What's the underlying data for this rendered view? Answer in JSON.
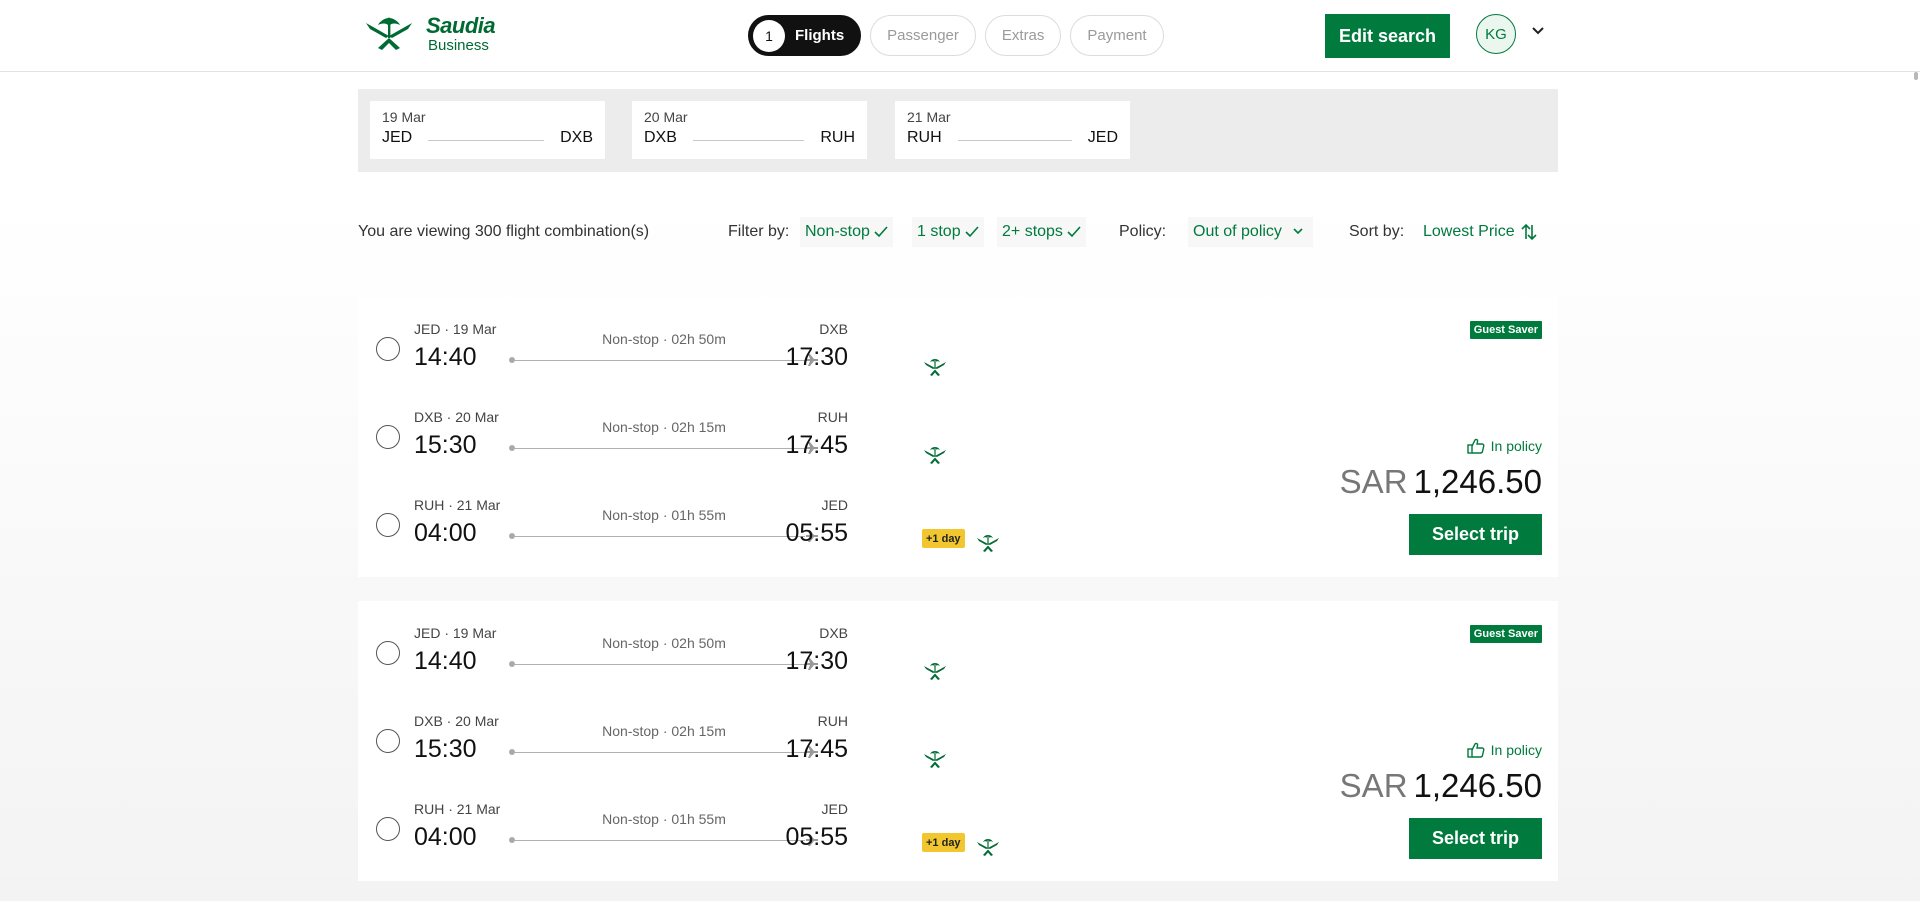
{
  "brand": {
    "name": "Saudia",
    "sub": "Business"
  },
  "steps": [
    {
      "num": "1",
      "label": "Flights",
      "active": true
    },
    {
      "label": "Passenger"
    },
    {
      "label": "Extras"
    },
    {
      "label": "Payment"
    }
  ],
  "header": {
    "edit_search": "Edit search",
    "avatar": "KG"
  },
  "routes": [
    {
      "date": "19 Mar",
      "from": "JED",
      "to": "DXB"
    },
    {
      "date": "20 Mar",
      "from": "DXB",
      "to": "RUH"
    },
    {
      "date": "21 Mar",
      "from": "RUH",
      "to": "JED"
    }
  ],
  "results": {
    "summary": "You are viewing 300 flight combination(s)",
    "filter_label": "Filter by:",
    "filters": [
      "Non-stop",
      "1 stop",
      "2+ stops"
    ],
    "policy_label": "Policy:",
    "policy_value": "Out of policy",
    "sort_label": "Sort by:",
    "sort_value": "Lowest Price"
  },
  "cards": [
    {
      "badge": "Guest Saver",
      "policy": "In policy",
      "currency": "SAR",
      "price": "1,246.50",
      "select": "Select trip",
      "legs": [
        {
          "dep_label": "JED · 19 Mar",
          "dep_time": "14:40",
          "info": "Non-stop · 02h 50m",
          "arr_label": "DXB",
          "arr_time": "17:30",
          "plus": ""
        },
        {
          "dep_label": "DXB · 20 Mar",
          "dep_time": "15:30",
          "info": "Non-stop · 02h 15m",
          "arr_label": "RUH",
          "arr_time": "17:45",
          "plus": ""
        },
        {
          "dep_label": "RUH · 21 Mar",
          "dep_time": "04:00",
          "info": "Non-stop · 01h 55m",
          "arr_label": "JED",
          "arr_time": "05:55",
          "plus": "+1 day"
        }
      ]
    },
    {
      "badge": "Guest Saver",
      "policy": "In policy",
      "currency": "SAR",
      "price": "1,246.50",
      "select": "Select trip",
      "legs": [
        {
          "dep_label": "JED · 19 Mar",
          "dep_time": "14:40",
          "info": "Non-stop · 02h 50m",
          "arr_label": "DXB",
          "arr_time": "17:30",
          "plus": ""
        },
        {
          "dep_label": "DXB · 20 Mar",
          "dep_time": "15:30",
          "info": "Non-stop · 02h 15m",
          "arr_label": "RUH",
          "arr_time": "17:45",
          "plus": ""
        },
        {
          "dep_label": "RUH · 21 Mar",
          "dep_time": "04:00",
          "info": "Non-stop · 01h 55m",
          "arr_label": "JED",
          "arr_time": "05:55",
          "plus": "+1 day"
        }
      ]
    }
  ],
  "colors": {
    "brand_green": "#007a3d",
    "plus_day": "#f2c62e"
  }
}
